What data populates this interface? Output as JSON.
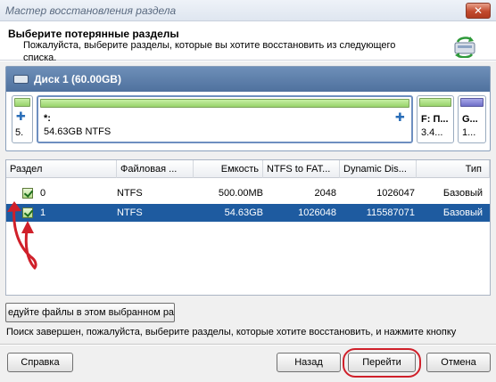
{
  "window": {
    "title": "Мастер восстановления раздела",
    "close_glyph": "✕"
  },
  "header": {
    "title": "Выберите потерянные разделы",
    "subtitle": "Пожалуйста, выберите разделы, которые вы хотите восстановить из следующего списка.",
    "icon": "recovery-icon"
  },
  "disk": {
    "label": "Диск 1 (60.00GB)",
    "partitions": [
      {
        "name": "5.",
        "info": "",
        "color": "green"
      },
      {
        "name": "*:",
        "info": "54.63GB NTFS",
        "color": "green"
      },
      {
        "name": "F: П...",
        "info": "3.4...",
        "color": "green"
      },
      {
        "name": "G...",
        "info": "1...",
        "color": "purple"
      }
    ]
  },
  "table": {
    "columns": [
      "Раздел",
      "Файловая ...",
      "Емкость",
      "NTFS to FAT...",
      "Dynamic Dis...",
      "Тип"
    ],
    "rows": [
      {
        "partition": "0",
        "fs": "NTFS",
        "capacity": "500.00MB",
        "ntfs_fat": "2048",
        "dynamic": "1026047",
        "type": "Базовый",
        "checked": true,
        "selected": false
      },
      {
        "partition": "1",
        "fs": "NTFS",
        "capacity": "54.63GB",
        "ntfs_fat": "1026048",
        "dynamic": "115587071",
        "type": "Базовый",
        "checked": true,
        "selected": true
      }
    ]
  },
  "files_button": "едуйте файлы в этом выбранном разд",
  "status": "Поиск завершен, пожалуйста, выберите разделы, которые хотите восстановить, и нажмите кнопку",
  "buttons": {
    "help": "Справка",
    "back": "Назад",
    "next": "Перейти",
    "cancel": "Отмена"
  },
  "colors": {
    "selection": "#1e5ba0",
    "annotation": "#d0202a",
    "disk_header": "#5a7aa8"
  }
}
